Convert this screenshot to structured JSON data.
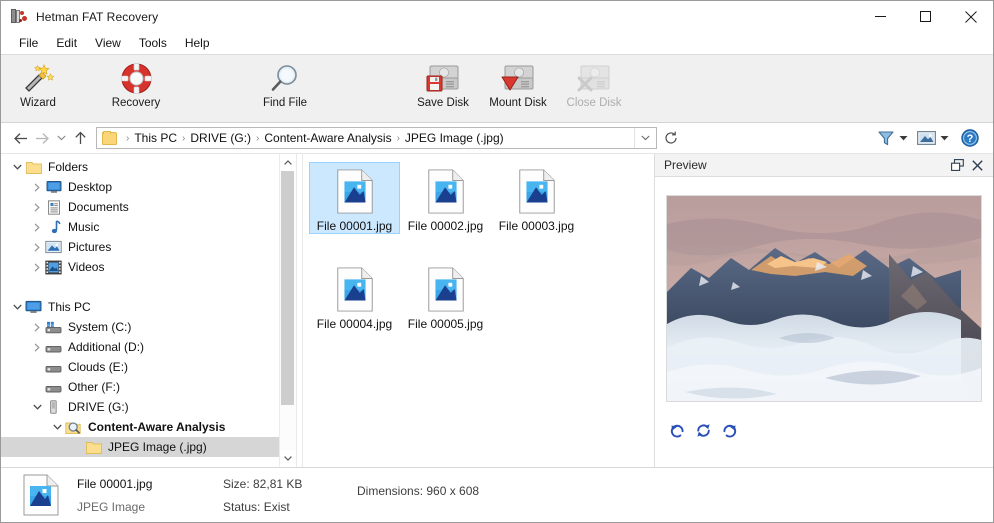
{
  "window": {
    "title": "Hetman FAT Recovery",
    "app_icon": "hetman-app-icon",
    "minimize": "minimize-button",
    "maximize": "maximize-button",
    "close": "close-button"
  },
  "menubar": {
    "items": [
      {
        "label": "File"
      },
      {
        "label": "Edit"
      },
      {
        "label": "View"
      },
      {
        "label": "Tools"
      },
      {
        "label": "Help"
      }
    ]
  },
  "toolbar": {
    "buttons": [
      {
        "label": "Wizard",
        "icon": "wand-stars-icon",
        "disabled": false
      },
      {
        "label": "Recovery",
        "icon": "lifebuoy-icon",
        "disabled": false
      },
      {
        "label": "Find File",
        "icon": "magnifier-icon",
        "disabled": false
      },
      {
        "label": "Save Disk",
        "icon": "save-disk-icon",
        "disabled": false
      },
      {
        "label": "Mount Disk",
        "icon": "mount-disk-icon",
        "disabled": false
      },
      {
        "label": "Close Disk",
        "icon": "close-disk-icon",
        "disabled": true
      }
    ]
  },
  "addressbar": {
    "back": "back-arrow-icon",
    "forward": "forward-arrow-icon",
    "history": "history-chevron-icon",
    "up": "up-arrow-icon",
    "folder_icon": "folder-icon",
    "breadcrumbs": [
      "This PC",
      "DRIVE (G:)",
      "Content-Aware Analysis",
      "JPEG Image (.jpg)"
    ],
    "separator": "›",
    "dropdown": "chevron-down-icon",
    "refresh": "refresh-icon",
    "filter": "filter-funnel-icon",
    "filter_caret": "caret-down-icon",
    "view": "view-mode-icon",
    "view_caret": "caret-down-icon",
    "help": "help-circle-icon"
  },
  "tree": {
    "nodes": [
      {
        "label": "Folders",
        "icon": "folder-icon",
        "indent": 0,
        "twisty": "down",
        "selected": false,
        "bold": false
      },
      {
        "label": "Desktop",
        "icon": "desktop-icon",
        "indent": 1,
        "twisty": "right",
        "selected": false,
        "bold": false
      },
      {
        "label": "Documents",
        "icon": "documents-icon",
        "indent": 1,
        "twisty": "right",
        "selected": false,
        "bold": false
      },
      {
        "label": "Music",
        "icon": "music-note-icon",
        "indent": 1,
        "twisty": "right",
        "selected": false,
        "bold": false
      },
      {
        "label": "Pictures",
        "icon": "pictures-icon",
        "indent": 1,
        "twisty": "right",
        "selected": false,
        "bold": false
      },
      {
        "label": "Videos",
        "icon": "videos-icon",
        "indent": 1,
        "twisty": "right",
        "selected": false,
        "bold": false
      },
      {
        "label": "",
        "icon": "spacer",
        "indent": 0,
        "twisty": "none",
        "selected": false,
        "bold": false
      },
      {
        "label": "This PC",
        "icon": "computer-icon",
        "indent": 0,
        "twisty": "down",
        "selected": false,
        "bold": false
      },
      {
        "label": "System (C:)",
        "icon": "system-drive-icon",
        "indent": 1,
        "twisty": "right",
        "selected": false,
        "bold": false
      },
      {
        "label": "Additional (D:)",
        "icon": "drive-icon",
        "indent": 1,
        "twisty": "right",
        "selected": false,
        "bold": false
      },
      {
        "label": "Clouds (E:)",
        "icon": "drive-icon",
        "indent": 1,
        "twisty": "none",
        "selected": false,
        "bold": false
      },
      {
        "label": "Other (F:)",
        "icon": "drive-icon",
        "indent": 1,
        "twisty": "none",
        "selected": false,
        "bold": false
      },
      {
        "label": "DRIVE (G:)",
        "icon": "usb-drive-icon",
        "indent": 1,
        "twisty": "down",
        "selected": false,
        "bold": false
      },
      {
        "label": "Content-Aware Analysis",
        "icon": "magnifier-folder-icon",
        "indent": 2,
        "twisty": "down",
        "selected": false,
        "bold": true
      },
      {
        "label": "JPEG Image (.jpg)",
        "icon": "folder-icon",
        "indent": 3,
        "twisty": "none",
        "selected": true,
        "bold": false
      }
    ],
    "scrollbar": {
      "up": "scroll-up-arrow",
      "down": "scroll-down-arrow"
    }
  },
  "files": {
    "items": [
      {
        "name": "File 00001.jpg",
        "icon": "jpeg-file-icon",
        "selected": true
      },
      {
        "name": "File 00002.jpg",
        "icon": "jpeg-file-icon",
        "selected": false
      },
      {
        "name": "File 00003.jpg",
        "icon": "jpeg-file-icon",
        "selected": false
      },
      {
        "name": "File 00004.jpg",
        "icon": "jpeg-file-icon",
        "selected": false
      },
      {
        "name": "File 00005.jpg",
        "icon": "jpeg-file-icon",
        "selected": false
      }
    ]
  },
  "preview": {
    "title": "Preview",
    "undock": "undock-icon",
    "close": "close-icon",
    "image_alt": "mountain-sunset-above-clouds",
    "rotate_left": "rotate-left-icon",
    "rotate_180": "rotate-180-icon",
    "rotate_right": "rotate-right-icon"
  },
  "status": {
    "icon": "jpeg-file-icon",
    "file_name": "File 00001.jpg",
    "file_type": "JPEG Image",
    "size": "Size: 82,81 KB",
    "state": "Status: Exist",
    "dimensions": "Dimensions: 960 x 608"
  },
  "colors": {
    "selection": "#cce8ff",
    "selection_border": "#99d1ff",
    "tree_selection": "#d6d6d6",
    "toolbar_bg": "#f0f0f0",
    "accent_blue": "#2a4fb5",
    "folder_yellow": "#fbd679"
  }
}
